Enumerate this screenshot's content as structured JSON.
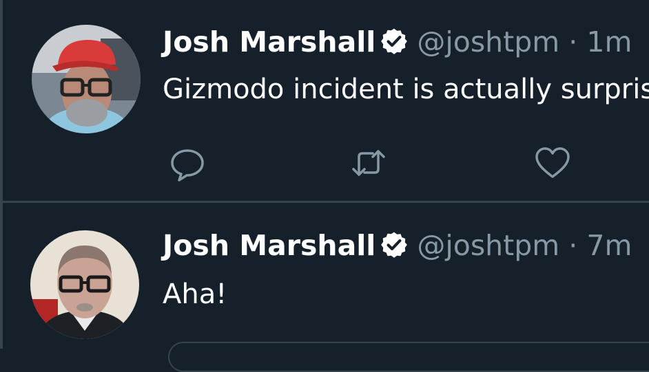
{
  "tweets": [
    {
      "author_name": "Josh Marshall",
      "handle": "@joshtpm",
      "separator": "·",
      "time": "1m",
      "text": "Gizmodo incident is actually surpris",
      "verified": true
    },
    {
      "author_name": "Josh Marshall",
      "handle": "@joshtpm",
      "separator": "·",
      "time": "7m",
      "text": "Aha!",
      "verified": true
    }
  ],
  "icons": {
    "reply": "reply-icon",
    "retweet": "retweet-icon",
    "like": "heart-icon",
    "verified": "verified-badge-icon"
  },
  "colors": {
    "background": "#15202b",
    "divider": "#38444d",
    "primary_text": "#ffffff",
    "secondary_text": "#8899a6"
  }
}
